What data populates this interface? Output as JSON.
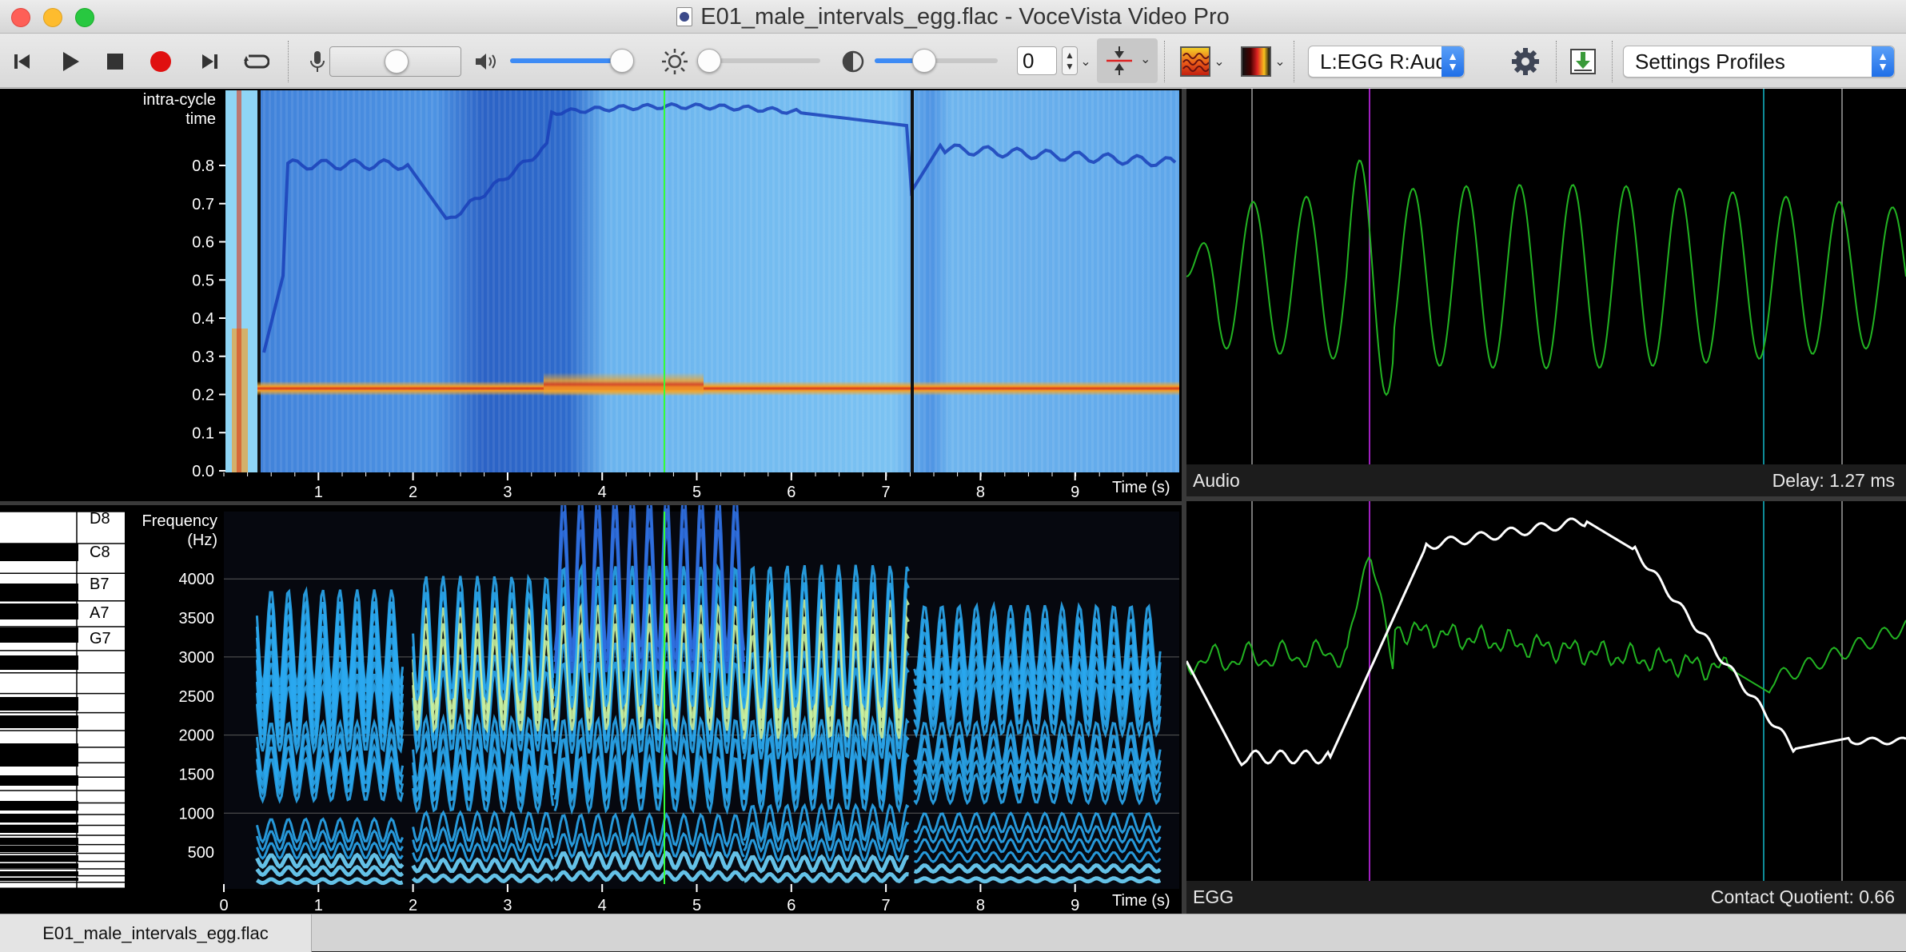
{
  "window": {
    "title": "E01_male_intervals_egg.flac - VoceVista Video Pro"
  },
  "toolbar": {
    "icons": [
      "skip-back-icon",
      "play-icon",
      "stop-icon",
      "record-icon",
      "skip-forward-icon",
      "loop-icon"
    ],
    "input_gain_level": 0.5,
    "volume_level": 1.0,
    "brightness_level": 0.1,
    "contrast_level": 0.4,
    "offset_value": "0",
    "channel_select": "L:EGG R:Audio",
    "settings_profiles": "Settings Profiles",
    "colors": {
      "accent": "#3d8bf5",
      "record": "#e01010"
    }
  },
  "spectrogram_top": {
    "ylabel_line1": "intra-cycle",
    "ylabel_line2": "time",
    "yticks": [
      "0.8",
      "0.7",
      "0.6",
      "0.5",
      "0.4",
      "0.3",
      "0.2",
      "0.1",
      "0.0"
    ],
    "xticks": [
      "1",
      "2",
      "3",
      "4",
      "5",
      "6",
      "7",
      "8",
      "9"
    ],
    "xlabel": "Time (s)"
  },
  "spectrogram_bottom": {
    "ylabel_line1": "Frequency",
    "ylabel_line2": "(Hz)",
    "yticks": [
      "4000",
      "3500",
      "3000",
      "2500",
      "2000",
      "1500",
      "1000",
      "500"
    ],
    "xticks": [
      "0",
      "1",
      "2",
      "3",
      "4",
      "5",
      "6",
      "7",
      "8",
      "9"
    ],
    "xlabel": "Time (s)",
    "notes": [
      "D8",
      "C8",
      "B7",
      "A7",
      "G7"
    ]
  },
  "audio_panel": {
    "label": "Audio",
    "delay": "Delay: 1.27 ms"
  },
  "egg_panel": {
    "label": "EGG",
    "contact_quotient": "Contact Quotient: 0.66"
  },
  "file_tab": {
    "label": "E01_male_intervals_egg.flac"
  }
}
